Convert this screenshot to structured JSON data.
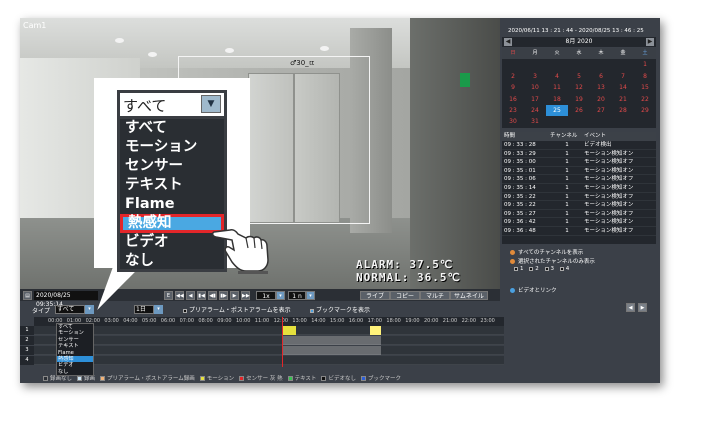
{
  "camera": {
    "name": "Cam1",
    "box_tag": "♂30_ㄸ",
    "alarm_line": "ALARM: 37.5℃",
    "normal_line": "NORMAL: 36.5℃"
  },
  "calendar": {
    "range": "2020/06/11  13 : 21 : 44 - 2020/08/25  13 : 46 : 25",
    "prev": "◀",
    "next": "▶",
    "month": "8月   2020",
    "weekdays": [
      "日",
      "月",
      "火",
      "水",
      "木",
      "金",
      "土"
    ],
    "weeks": [
      [
        "",
        "",
        "",
        "",
        "",
        "",
        "1"
      ],
      [
        "2",
        "3",
        "4",
        "5",
        "6",
        "7",
        "8"
      ],
      [
        "9",
        "10",
        "11",
        "12",
        "13",
        "14",
        "15"
      ],
      [
        "16",
        "17",
        "18",
        "19",
        "20",
        "21",
        "22"
      ],
      [
        "23",
        "24",
        "25",
        "26",
        "27",
        "28",
        "29"
      ],
      [
        "30",
        "31",
        "",
        "",
        "",
        "",
        ""
      ]
    ],
    "selected": "25"
  },
  "events": {
    "headers": [
      "時間",
      "チャンネル",
      "イベント"
    ],
    "rows": [
      [
        "09 : 33 : 28",
        "1",
        "ビデオ検出"
      ],
      [
        "09 : 33 : 29",
        "1",
        "モーション検知オン"
      ],
      [
        "09 : 35 : 00",
        "1",
        "モーション検知オフ"
      ],
      [
        "09 : 35 : 01",
        "1",
        "モーション検知オン"
      ],
      [
        "09 : 35 : 06",
        "1",
        "モーション検知オフ"
      ],
      [
        "09 : 35 : 14",
        "1",
        "モーション検知オン"
      ],
      [
        "09 : 35 : 22",
        "1",
        "モーション検知オフ"
      ],
      [
        "09 : 35 : 22",
        "1",
        "モーション検知オン"
      ],
      [
        "09 : 35 : 27",
        "1",
        "モーション検知オフ"
      ],
      [
        "09 : 36 : 42",
        "1",
        "モーション検知オン"
      ],
      [
        "09 : 36 : 48",
        "1",
        "モーション検知オフ"
      ]
    ]
  },
  "options": {
    "all_channels": "すべてのチャンネルを表示",
    "selected_only": "選択されたチャンネルのみ表示",
    "ch": [
      "1",
      "2",
      "3",
      "4"
    ],
    "link": "ビデオとリンク"
  },
  "toolbar": {
    "datetime": "2020/08/25  09:35:14",
    "speed": "1x",
    "unit": "1 n",
    "btns": [
      "ライブ",
      "コピー",
      "マルチ",
      "サムネイル"
    ],
    "transport": [
      "◀◀",
      "◀",
      "▮◀",
      "◀▮",
      "▮▶",
      "▶",
      "▶▶",
      "E"
    ]
  },
  "filter": {
    "type_label": "タイプ",
    "type_value": "すべて",
    "zoom_value": "1日",
    "pre_alarm": "プリアラーム・ポストアラームを表示",
    "bookmark": "ブックマークを表示"
  },
  "timeline": {
    "hours": [
      "00:00",
      "01:00",
      "02:00",
      "03:00",
      "04:00",
      "05:00",
      "06:00",
      "07:00",
      "08:00",
      "09:00",
      "10:00",
      "11:00",
      "12:00",
      "13:00",
      "14:00",
      "15:00",
      "16:00",
      "17:00",
      "18:00",
      "19:00",
      "20:00",
      "21:00",
      "22:00",
      "23:00"
    ],
    "rows": [
      "1",
      "2",
      "3",
      "4"
    ]
  },
  "type_options": [
    "すべて",
    "モーション",
    "センサー",
    "テキスト",
    "Flame",
    "熱感知",
    "ビデオ",
    "なし"
  ],
  "highlight": "熱感知",
  "legend": [
    {
      "label": "録画なし",
      "color": "#2b2f35"
    },
    {
      "label": "録画",
      "color": "#cfe6f5"
    },
    {
      "label": "プリアラーム・ポストアラーム録画",
      "color": "#f2b277"
    },
    {
      "label": "モーション",
      "color": "#e5e03d"
    },
    {
      "label": "センサー 灰 熱",
      "color": "#e3262a"
    },
    {
      "label": "テキスト",
      "color": "#39c052"
    },
    {
      "label": "ビデオなし",
      "color": "#111111"
    },
    {
      "label": "ブックマーク",
      "color": "#2d5fd8"
    }
  ]
}
